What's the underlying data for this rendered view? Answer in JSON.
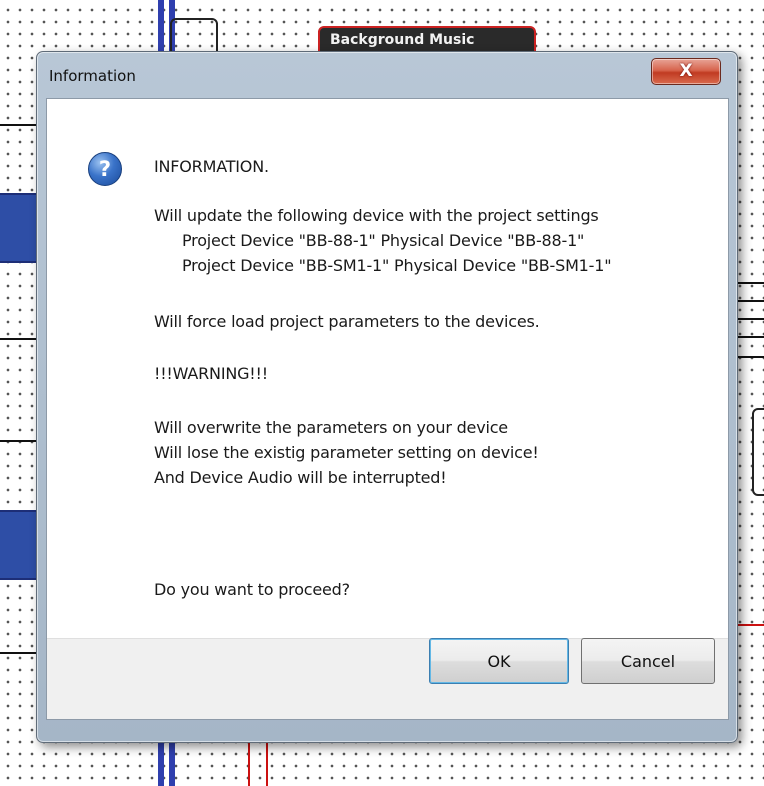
{
  "background": {
    "node_label": "Background Music"
  },
  "dialog": {
    "title": "Information",
    "close_symbol": "X",
    "icon": "question-icon",
    "lines": {
      "header": "INFORMATION.",
      "update_intro": "Will update the following device with the project settings",
      "device_1": "Project Device \"BB-88-1\" Physical Device \"BB-88-1\"",
      "device_2": "Project Device \"BB-SM1-1\" Physical Device \"BB-SM1-1\"",
      "force_load": "Will force load project parameters to the devices.",
      "warning": "!!!WARNING!!!",
      "overwrite": "Will overwrite the parameters on your device",
      "lose": "Will lose the existig parameter setting on device!",
      "interrupt": "And Device Audio will be interrupted!",
      "question": "Do you want to proceed?"
    },
    "buttons": {
      "ok": "OK",
      "cancel": "Cancel"
    }
  },
  "colors": {
    "close_button": "#c13b22",
    "question_icon": "#3a73c9",
    "background_blue": "#2e4ea6"
  }
}
